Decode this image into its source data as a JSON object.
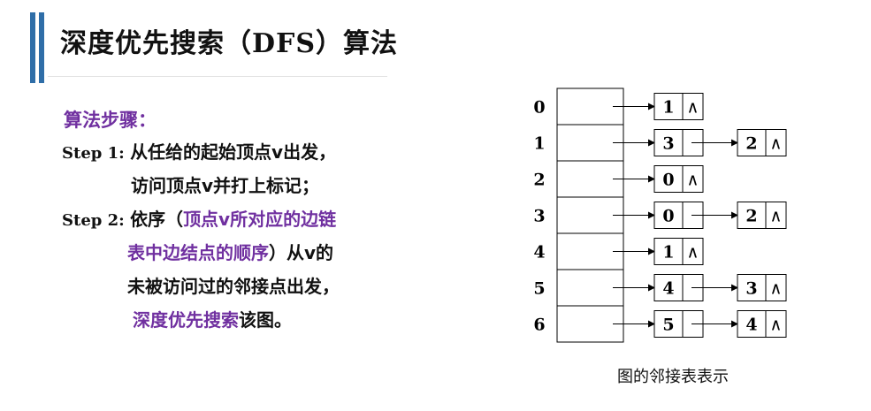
{
  "header": {
    "title_prefix": "深度优先搜索（",
    "title_en": "DFS",
    "title_suffix": "）算法"
  },
  "steps": {
    "heading": "算法步骤：",
    "step1_label": "Step 1: ",
    "step1_line1": "从任给的起始顶点v出发，",
    "step1_line2": "访问顶点v并打上标记；",
    "step2_label": "Step 2: ",
    "step2_line1_a": "依序（",
    "step2_line1_b": "顶点v所对应的边链",
    "step2_line2_a": "表中边结点的顺序",
    "step2_line2_b": "）从v的",
    "step2_line3": "未被访问过的邻接点出发，",
    "step2_line4_a": "深度优先搜索",
    "step2_line4_b": "该图。"
  },
  "diagram": {
    "caption": "图的邻接表表示",
    "null_symbol": "∧",
    "vertices": [
      "0",
      "1",
      "2",
      "3",
      "4",
      "5",
      "6"
    ],
    "adjacency": [
      [
        "1"
      ],
      [
        "3",
        "2"
      ],
      [
        "0"
      ],
      [
        "0",
        "2"
      ],
      [
        "1"
      ],
      [
        "4",
        "3"
      ],
      [
        "5",
        "4"
      ]
    ]
  },
  "colors": {
    "accent_bar": "#2f6ea8",
    "highlight_purple": "#7030a0",
    "text": "#111111"
  }
}
